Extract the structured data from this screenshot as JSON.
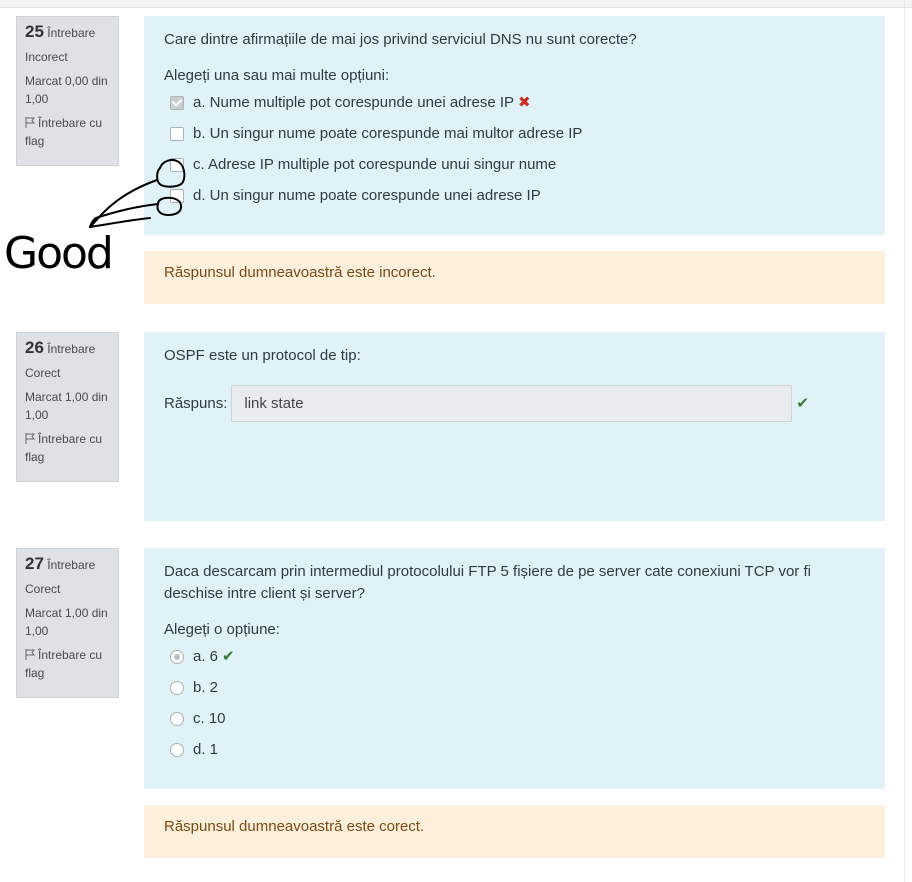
{
  "questions": [
    {
      "number": "25",
      "label": "Întrebare",
      "state": "Incorect",
      "mark": "Marcat 0,00 din 1,00",
      "flag": "Întrebare cu flag",
      "text": "Care dintre afirmațiile de mai jos privind serviciul DNS nu sunt corecte?",
      "prompt": "Alegeți una sau mai multe opțiuni:",
      "options": [
        {
          "label": "a. Nume multiple pot corespunde unei adrese IP",
          "checked": true,
          "result": "wrong"
        },
        {
          "label": "b. Un singur nume poate corespunde mai multor adrese IP",
          "checked": false
        },
        {
          "label": "c. Adrese IP multiple pot corespunde unui singur nume",
          "checked": false
        },
        {
          "label": "d. Un singur nume poate corespunde unei adrese IP",
          "checked": false
        }
      ],
      "feedback": "Răspunsul dumneavoastră este incorect."
    },
    {
      "number": "26",
      "label": "Întrebare",
      "state": "Corect",
      "mark": "Marcat 1,00 din 1,00",
      "flag": "Întrebare cu flag",
      "text": "OSPF este un protocol de tip:",
      "answer_label": "Răspuns:",
      "answer_value": "link state"
    },
    {
      "number": "27",
      "label": "Întrebare",
      "state": "Corect",
      "mark": "Marcat 1,00 din 1,00",
      "flag": "Întrebare cu flag",
      "text": "Daca descarcam prin intermediul protocolului FTP 5 fișiere de pe server cate conexiuni TCP vor fi deschise intre client și server?",
      "prompt": "Alegeți o opțiune:",
      "options": [
        {
          "label": "a. 6",
          "checked": true,
          "result": "right"
        },
        {
          "label": "b. 2",
          "checked": false
        },
        {
          "label": "c. 10",
          "checked": false
        },
        {
          "label": "d. 1",
          "checked": false
        }
      ],
      "feedback": "Răspunsul dumneavoastră este corect."
    }
  ],
  "annotation": {
    "text": "Good",
    "color": "#000000"
  },
  "colors": {
    "question_bg": "#def2f8",
    "feedback_bg": "#fcefdc",
    "info_bg": "#dee2e6",
    "wrong": "#ca3120",
    "right": "#357a32"
  },
  "icons": {
    "flag": "flag-icon",
    "wrong": "cross-icon",
    "right": "check-icon"
  }
}
